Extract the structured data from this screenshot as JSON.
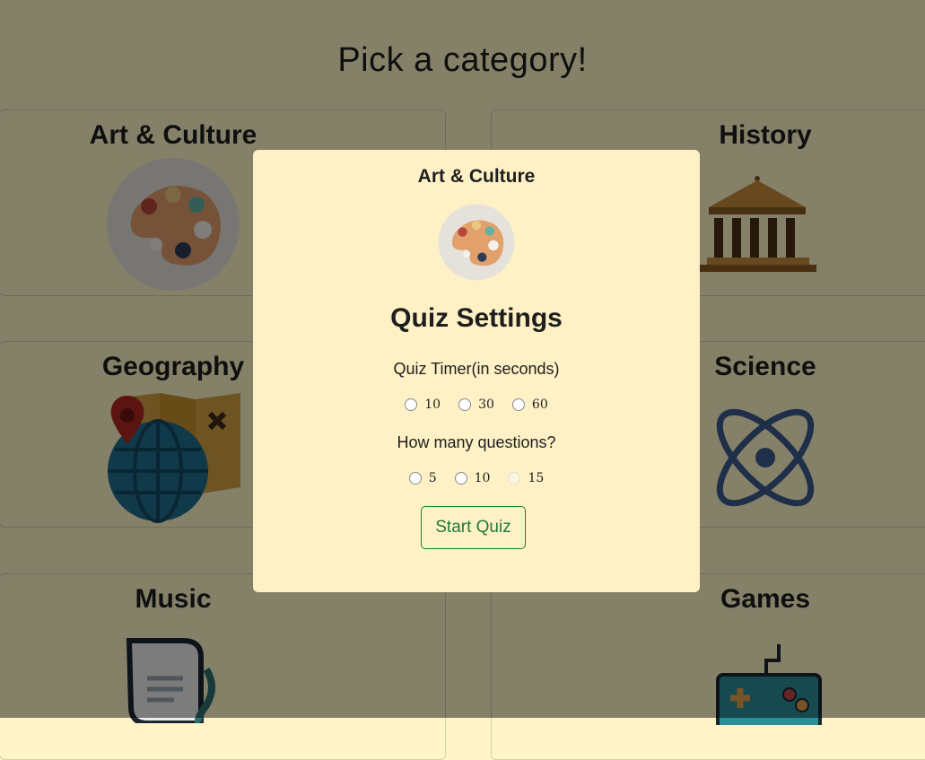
{
  "page": {
    "title": "Pick a category!"
  },
  "categories": [
    {
      "label": "Art & Culture",
      "icon": "palette-icon"
    },
    {
      "label": "History",
      "icon": "temple-icon"
    },
    {
      "label": "Geography",
      "icon": "globe-map-icon"
    },
    {
      "label": "Science",
      "icon": "atom-icon"
    },
    {
      "label": "Music",
      "icon": "music-scroll-icon"
    },
    {
      "label": "Games",
      "icon": "gamepad-icon"
    }
  ],
  "modal": {
    "category_title": "Art & Culture",
    "category_icon": "palette-icon",
    "heading": "Quiz Settings",
    "timer": {
      "label": "Quiz Timer(in seconds)",
      "options": [
        "10",
        "30",
        "60"
      ]
    },
    "questions": {
      "label": "How many questions?",
      "options": [
        "5",
        "10",
        "15"
      ]
    },
    "start_label": "Start Quiz"
  },
  "colors": {
    "page_bg": "#fff5c8",
    "overlay": "rgba(0,0,0,0.48)",
    "modal_bg": "#fff1c6",
    "start_button": "#1f7a3a"
  }
}
